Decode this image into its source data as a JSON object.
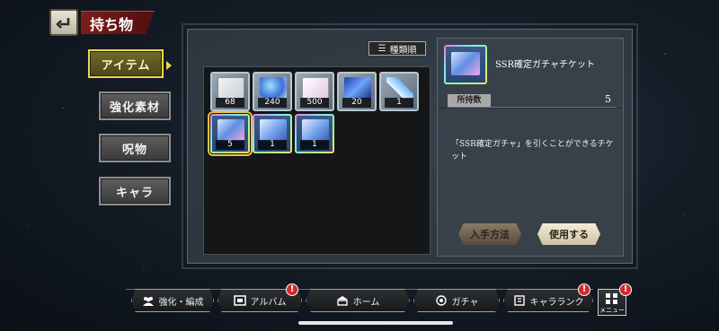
{
  "header": {
    "title": "持ち物"
  },
  "side_tabs": [
    {
      "label": "アイテム",
      "active": true
    },
    {
      "label": "強化素材",
      "active": false
    },
    {
      "label": "呪物",
      "active": false
    },
    {
      "label": "キャラ",
      "active": false
    }
  ],
  "sort": {
    "label": "種類順"
  },
  "items": [
    {
      "icon": "paper-ticket-icon",
      "qty": "68",
      "rarity": "silver"
    },
    {
      "icon": "blue-crystal-pouch-icon",
      "qty": "240",
      "rarity": "silver"
    },
    {
      "icon": "dice-cards-icon",
      "qty": "500",
      "rarity": "silver"
    },
    {
      "icon": "blue-crystal-icon",
      "qty": "20",
      "rarity": "silver"
    },
    {
      "icon": "blue-tag-icon",
      "qty": "1",
      "rarity": "silver"
    },
    {
      "icon": "ssr-gacha-ticket-icon",
      "qty": "5",
      "rarity": "rainbow",
      "selected": true
    },
    {
      "icon": "gacha-ticket-icon",
      "qty": "1",
      "rarity": "rainbow"
    },
    {
      "icon": "gacha-ticket-icon",
      "qty": "1",
      "rarity": "rainbow"
    }
  ],
  "detail": {
    "name": "SSR確定ガチャチケット",
    "owned_label": "所持数",
    "owned_value": "5",
    "description": "「SSR確定ガチャ」を引くことができるチケット",
    "acquire_label": "入手方法",
    "use_label": "使用する"
  },
  "bottom_nav": [
    {
      "label": "強化・編成",
      "icon": "team-icon",
      "badge": ""
    },
    {
      "label": "アルバム",
      "icon": "album-icon",
      "badge": "!"
    },
    {
      "label": "ホーム",
      "icon": "home-icon",
      "badge": ""
    },
    {
      "label": "ガチャ",
      "icon": "gacha-icon",
      "badge": ""
    },
    {
      "label": "キャラランク",
      "icon": "rank-icon",
      "badge": "!"
    }
  ],
  "menu": {
    "label": "メニュー",
    "badge": "!"
  },
  "colors": {
    "accent_gold": "#f1d64a",
    "title_red": "#7c1e1a",
    "badge_red": "#d22a2a"
  }
}
